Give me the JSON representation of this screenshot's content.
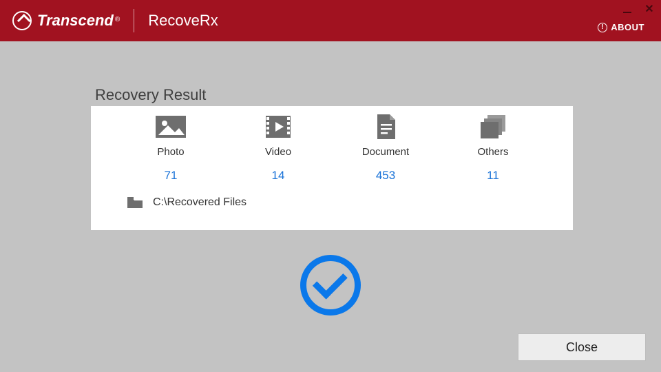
{
  "header": {
    "brand": "Transcend",
    "app_name": "RecoveRx",
    "about_label": "ABOUT"
  },
  "result": {
    "title": "Recovery Result",
    "categories": [
      {
        "label": "Photo",
        "count": "71"
      },
      {
        "label": "Video",
        "count": "14"
      },
      {
        "label": "Document",
        "count": "453"
      },
      {
        "label": "Others",
        "count": "11"
      }
    ],
    "output_path": "C:\\Recovered Files"
  },
  "buttons": {
    "close": "Close"
  }
}
